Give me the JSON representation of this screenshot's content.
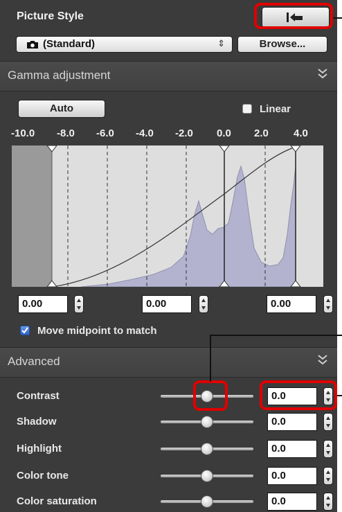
{
  "picture_style": {
    "title": "Picture Style",
    "selected": "(Standard)",
    "browse_label": "Browse..."
  },
  "gamma": {
    "section_title": "Gamma adjustment",
    "auto_label": "Auto",
    "linear_label": "Linear",
    "linear_checked": false,
    "ticks": [
      "-10.0",
      "-8.0",
      "-6.0",
      "-4.0",
      "-2.0",
      "0.0",
      "2.0",
      "4.0"
    ],
    "fields": [
      "0.00",
      "0.00",
      "0.00"
    ],
    "move_midpoint_label": "Move midpoint to match",
    "move_midpoint_checked": true
  },
  "advanced": {
    "section_title": "Advanced",
    "rows": [
      {
        "label": "Contrast",
        "value": "0.0",
        "level": 0.5
      },
      {
        "label": "Shadow",
        "value": "0.0",
        "level": 0.5
      },
      {
        "label": "Highlight",
        "value": "0.0",
        "level": 0.5
      },
      {
        "label": "Color tone",
        "value": "0.0",
        "level": 0.5
      },
      {
        "label": "Color saturation",
        "value": "0.0",
        "level": 0.5
      }
    ]
  },
  "colors": {
    "panel_bg": "#3b3b3b",
    "highlight": "#e00000",
    "histogram_fill": "#b3b3cf",
    "graph_bg": "#dedede"
  }
}
